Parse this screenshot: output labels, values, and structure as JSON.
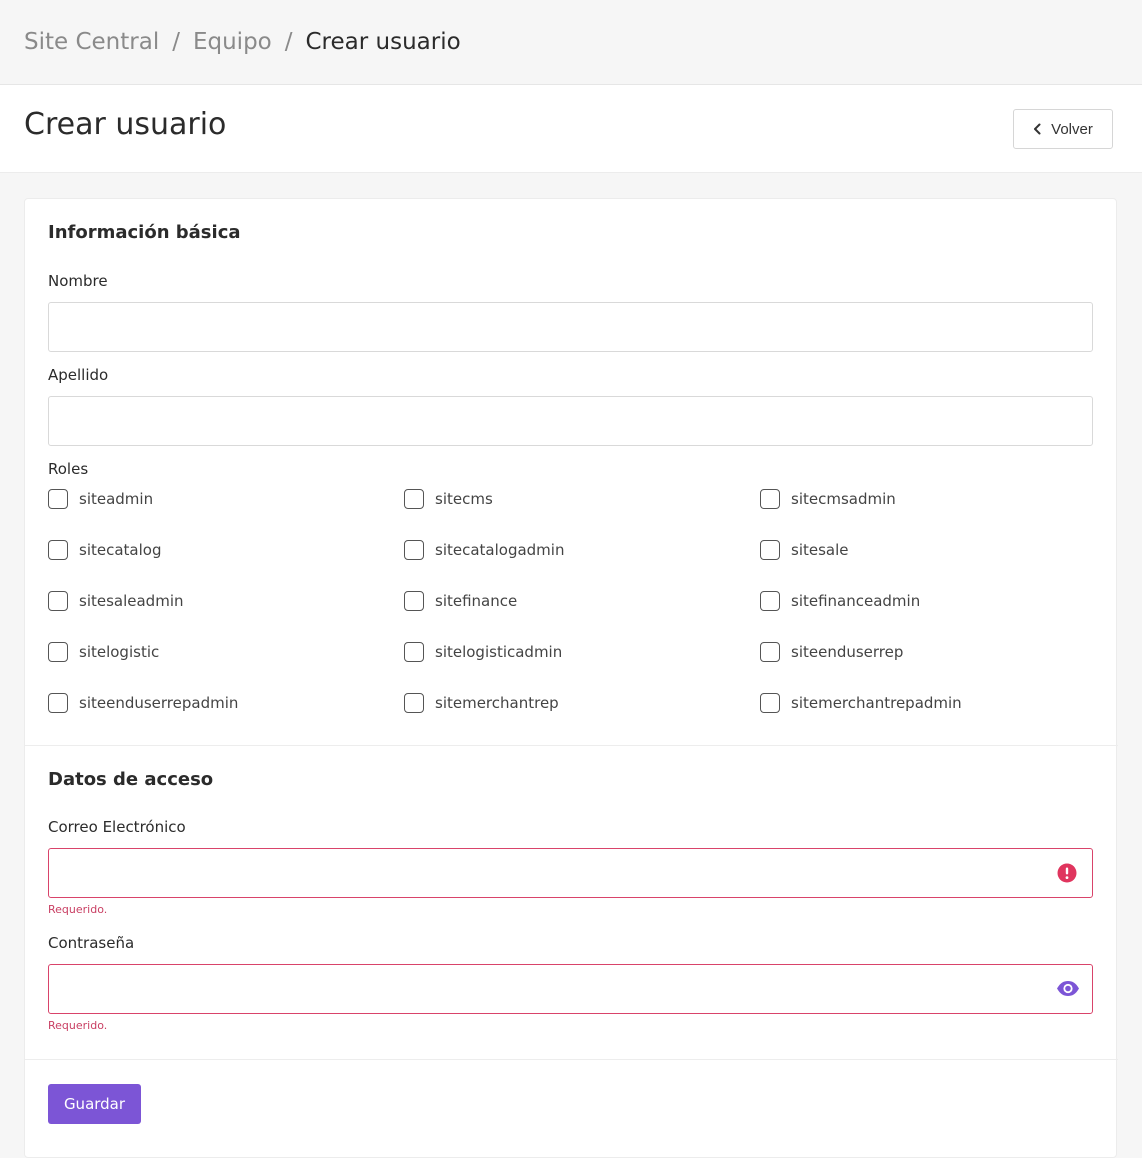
{
  "breadcrumb": {
    "items": [
      "Site Central",
      "Equipo",
      "Crear usuario"
    ],
    "separator": "/"
  },
  "header": {
    "title": "Crear usuario",
    "back_label": "Volver"
  },
  "basic_info": {
    "title": "Información básica",
    "nombre_label": "Nombre",
    "nombre_value": "",
    "apellido_label": "Apellido",
    "apellido_value": "",
    "roles_label": "Roles",
    "roles": [
      {
        "label": "siteadmin",
        "checked": false
      },
      {
        "label": "sitecms",
        "checked": false
      },
      {
        "label": "sitecmsadmin",
        "checked": false
      },
      {
        "label": "sitecatalog",
        "checked": false
      },
      {
        "label": "sitecatalogadmin",
        "checked": false
      },
      {
        "label": "sitesale",
        "checked": false
      },
      {
        "label": "sitesaleadmin",
        "checked": false
      },
      {
        "label": "sitefinance",
        "checked": false
      },
      {
        "label": "sitefinanceadmin",
        "checked": false
      },
      {
        "label": "sitelogistic",
        "checked": false
      },
      {
        "label": "sitelogisticadmin",
        "checked": false
      },
      {
        "label": "siteenduserrep",
        "checked": false
      },
      {
        "label": "siteenduserrepadmin",
        "checked": false
      },
      {
        "label": "sitemerchantrep",
        "checked": false
      },
      {
        "label": "sitemerchantrepadmin",
        "checked": false
      }
    ]
  },
  "access": {
    "title": "Datos de acceso",
    "email_label": "Correo Electrónico",
    "email_value": "",
    "email_error": "Requerido.",
    "password_label": "Contraseña",
    "password_value": "",
    "password_error": "Requerido."
  },
  "actions": {
    "save_label": "Guardar"
  },
  "colors": {
    "accent": "#7c55d6",
    "error": "#d9436a",
    "error_icon": "#e0355e"
  },
  "icons": {
    "back": "chevron-left-icon",
    "email_status": "error-icon",
    "password_toggle": "eye-icon"
  }
}
